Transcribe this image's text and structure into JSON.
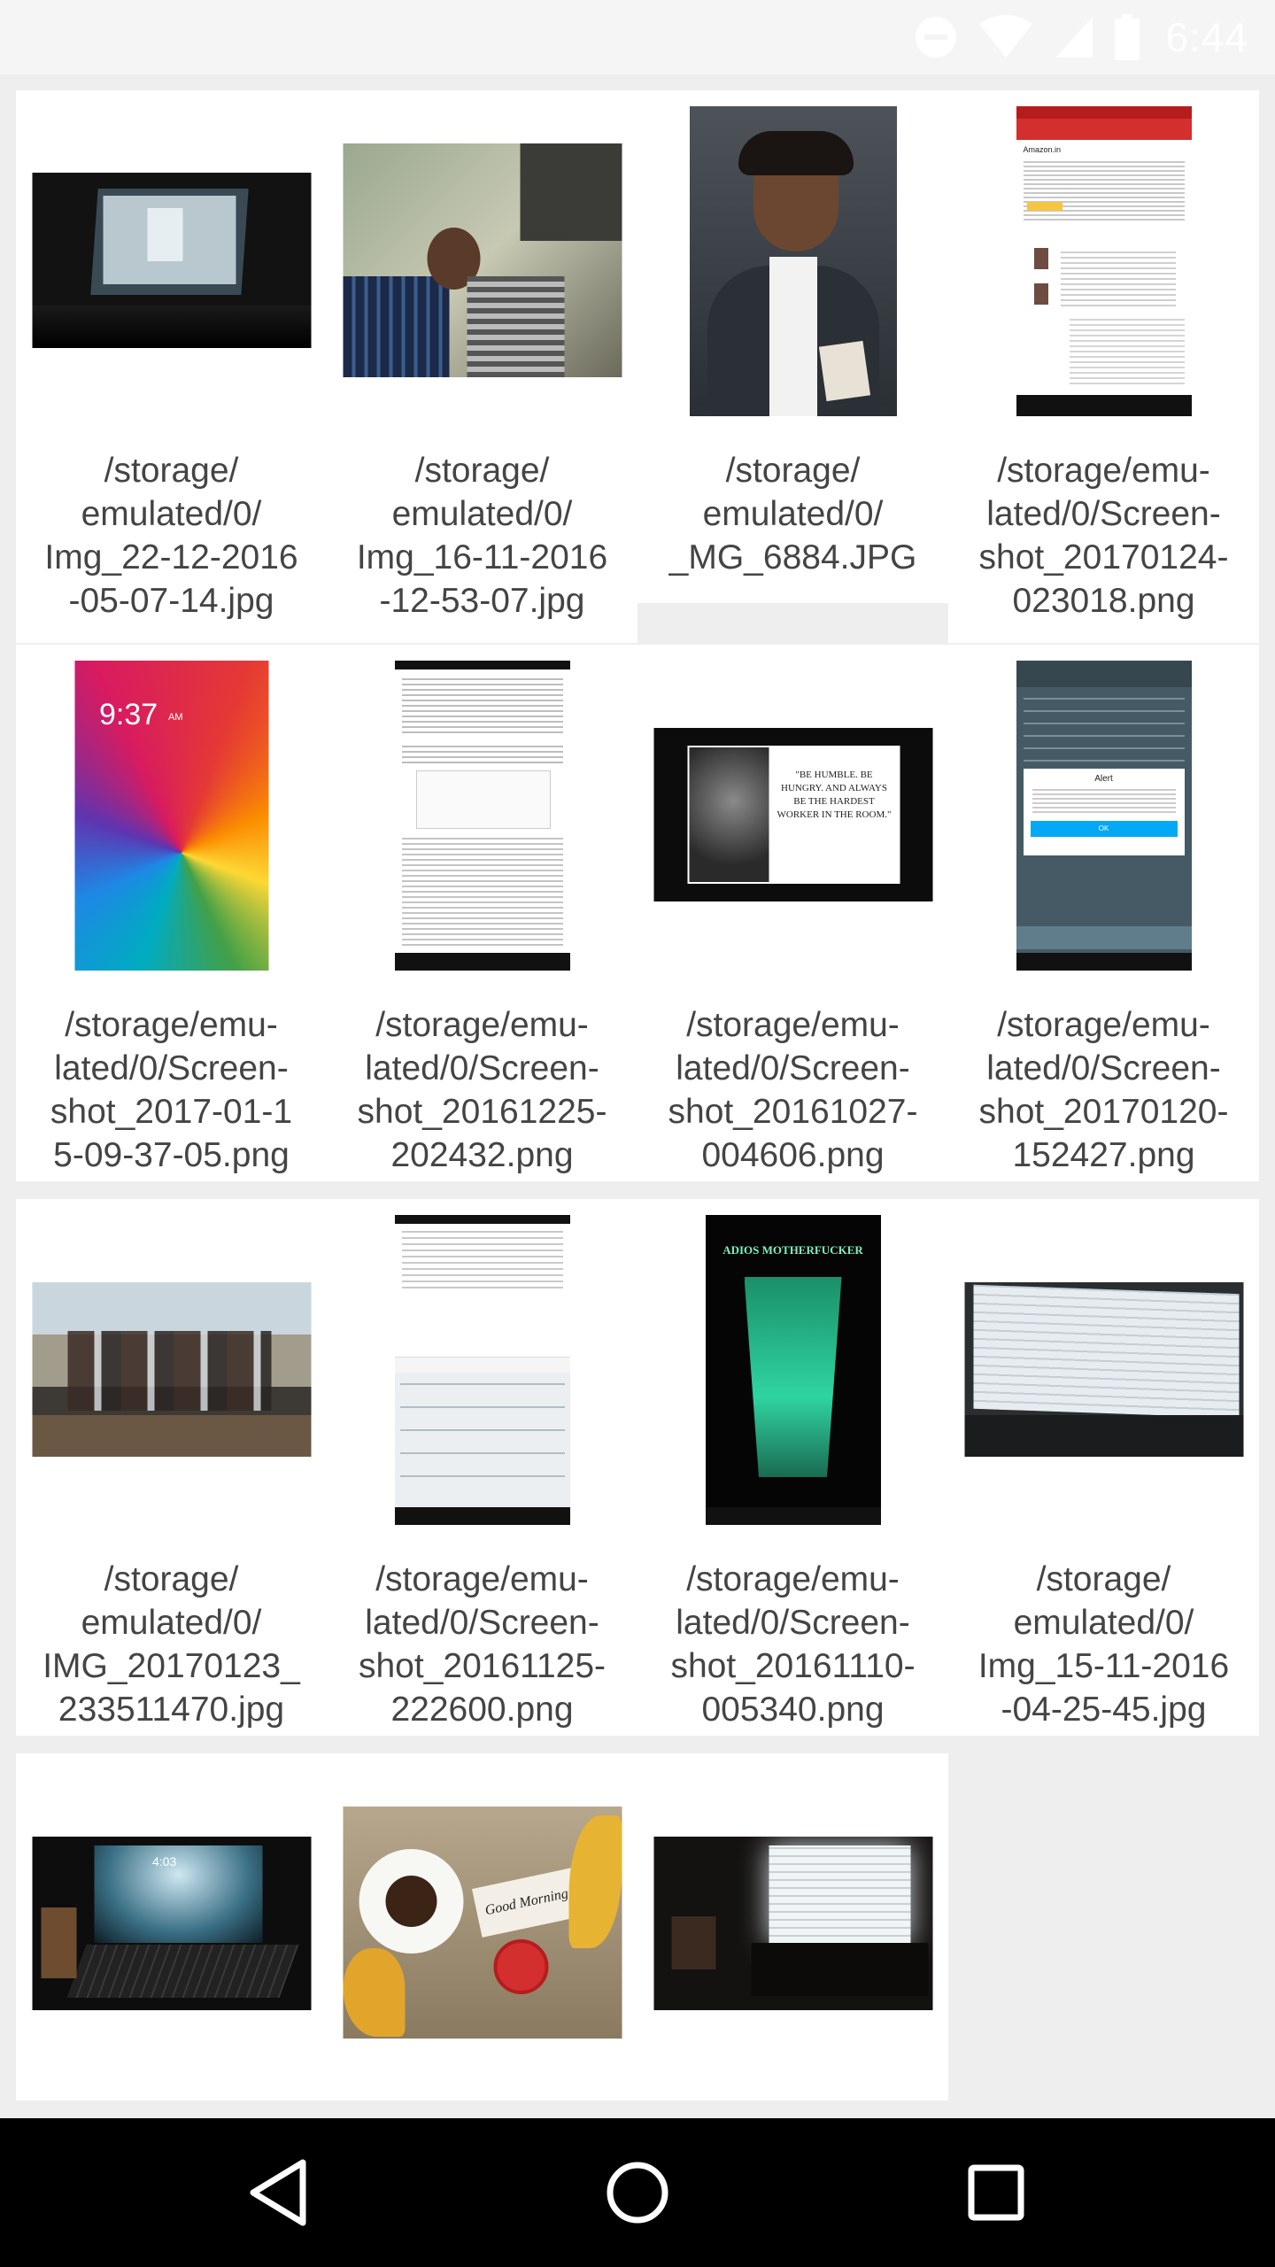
{
  "status_bar": {
    "time": "6:44",
    "icons": [
      "do-not-disturb-icon",
      "wifi-icon",
      "signal-icon",
      "battery-icon"
    ]
  },
  "gallery": {
    "items": [
      {
        "caption": "/storage/\nemulated/0/\nImg_22-12-2016\n-05-07-14.jpg"
      },
      {
        "caption": "/storage/\nemulated/0/\nImg_16-11-2016\n-12-53-07.jpg"
      },
      {
        "caption": "/storage/\nemulated/0/\n_MG_6884.JPG"
      },
      {
        "caption": "/storage/emu-\nlated/0/Screen-\nshot_20170124-\n023018.png"
      },
      {
        "caption": "/storage/emu-\nlated/0/Screen-\nshot_2017-01-1\n5-09-37-05.png"
      },
      {
        "caption": "/storage/emu-\nlated/0/Screen-\nshot_20161225-\n202432.png"
      },
      {
        "caption": "/storage/emu-\nlated/0/Screen-\nshot_20161027-\n004606.png"
      },
      {
        "caption": "/storage/emu-\nlated/0/Screen-\nshot_20170120-\n152427.png"
      },
      {
        "caption": "/storage/\nemulated/0/\nIMG_20170123_\n233511470.jpg"
      },
      {
        "caption": "/storage/emu-\nlated/0/Screen-\nshot_20161125-\n222600.png"
      },
      {
        "caption": "/storage/emu-\nlated/0/Screen-\nshot_20161110-\n005340.png"
      },
      {
        "caption": "/storage/\nemulated/0/\nImg_15-11-2016\n-04-25-45.jpg"
      },
      {
        "caption": ""
      },
      {
        "caption": ""
      },
      {
        "caption": ""
      }
    ],
    "thumb_text": {
      "lock_time": "9:37",
      "lock_ampm": "AM",
      "quote": "\"BE HUMBLE. BE HUNGRY. AND ALWAYS BE THE HARDEST WORKER IN THE ROOM.\"",
      "alert_title": "Alert",
      "alert_ok": "OK",
      "laptop_time": "4:03",
      "note": "Good Morning!",
      "phone_header": "Amazon.in",
      "drink_title": "ADIOS MOTHERFUCKER"
    }
  },
  "nav_bar": {
    "buttons": [
      "back-icon",
      "home-icon",
      "recents-icon"
    ]
  }
}
